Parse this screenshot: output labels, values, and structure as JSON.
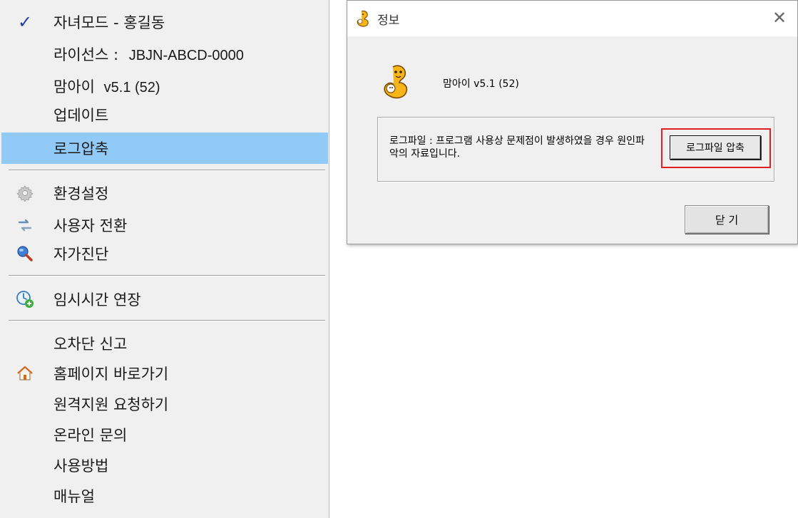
{
  "menu": {
    "items": [
      {
        "label": "자녀모드 - 홍길동",
        "icon": "check-icon",
        "checked": true
      },
      {
        "label": "라이선스 :",
        "value": "JBJN-ABCD-0000"
      },
      {
        "label": "맘아이",
        "value": "v5.1 (52)"
      },
      {
        "label": "업데이트"
      },
      {
        "label": "로그압축",
        "highlighted": true
      },
      {
        "label": "환경설정",
        "icon": "gear-icon"
      },
      {
        "label": "사용자 전환",
        "icon": "switch-user-icon"
      },
      {
        "label": "자가진단",
        "icon": "magnifier-icon"
      },
      {
        "label": "임시시간 연장",
        "icon": "clock-add-icon"
      },
      {
        "label": "오차단 신고"
      },
      {
        "label": "홈페이지 바로가기",
        "icon": "home-icon"
      },
      {
        "label": "원격지원 요청하기"
      },
      {
        "label": "온라인 문의"
      },
      {
        "label": "사용방법"
      },
      {
        "label": "매뉴얼"
      }
    ]
  },
  "dialog": {
    "title": "정보",
    "close_glyph": "✕",
    "app_version": "맘아이 v5.1 (52)",
    "group_description": "로그파일 : 프로그램 사용상 문제점이 발생하였을 경우 원인파악의 자료입니다.",
    "compress_button": "로그파일 압축",
    "close_button": "닫 기"
  },
  "colors": {
    "highlight": "#91c9f7",
    "check": "#1f3fa8",
    "focus_outline": "#e02020",
    "mascot": "#f6b51a"
  }
}
